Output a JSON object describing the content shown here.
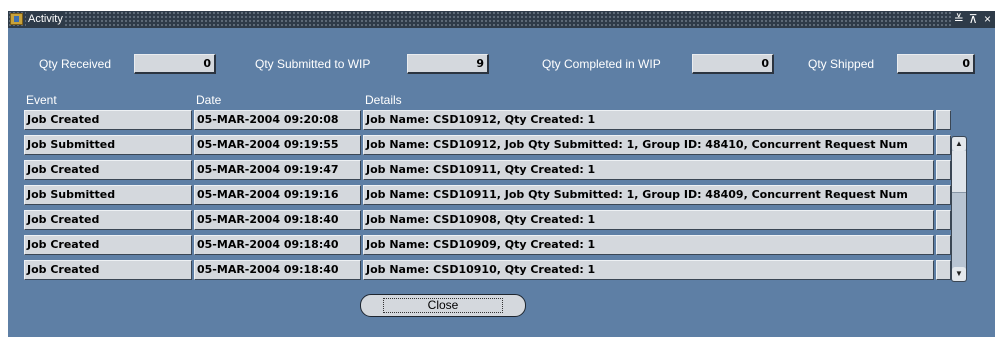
{
  "window": {
    "title": "Activity",
    "controls": [
      "≚",
      "⊼",
      "×"
    ]
  },
  "quantities": [
    {
      "label": "Qty Received",
      "value": "0"
    },
    {
      "label": "Qty Submitted to WIP",
      "value": "9"
    },
    {
      "label": "Qty Completed in WIP",
      "value": "0"
    },
    {
      "label": "Qty Shipped",
      "value": "0"
    }
  ],
  "table": {
    "headers": {
      "event": "Event",
      "date": "Date",
      "details": "Details"
    },
    "rows": [
      {
        "event": "Job Created",
        "date": "05-MAR-2004 09:20:08",
        "details": "Job Name: CSD10912, Qty Created: 1"
      },
      {
        "event": "Job Submitted",
        "date": "05-MAR-2004 09:19:55",
        "details": "Job Name: CSD10912, Job Qty Submitted: 1, Group ID: 48410, Concurrent Request Num"
      },
      {
        "event": "Job Created",
        "date": "05-MAR-2004 09:19:47",
        "details": "Job Name: CSD10911, Qty Created: 1"
      },
      {
        "event": "Job Submitted",
        "date": "05-MAR-2004 09:19:16",
        "details": "Job Name: CSD10911, Job Qty Submitted: 1, Group ID: 48409, Concurrent Request Num"
      },
      {
        "event": "Job Created",
        "date": "05-MAR-2004 09:18:40",
        "details": "Job Name: CSD10908, Qty Created: 1"
      },
      {
        "event": "Job Created",
        "date": "05-MAR-2004 09:18:40",
        "details": "Job Name: CSD10909, Qty Created: 1"
      },
      {
        "event": "Job Created",
        "date": "05-MAR-2004 09:18:40",
        "details": "Job Name: CSD10910, Qty Created: 1"
      }
    ]
  },
  "buttons": {
    "close_label": "Close"
  },
  "scrollbar": {
    "up_icon": "▲",
    "down_icon": "▼"
  }
}
